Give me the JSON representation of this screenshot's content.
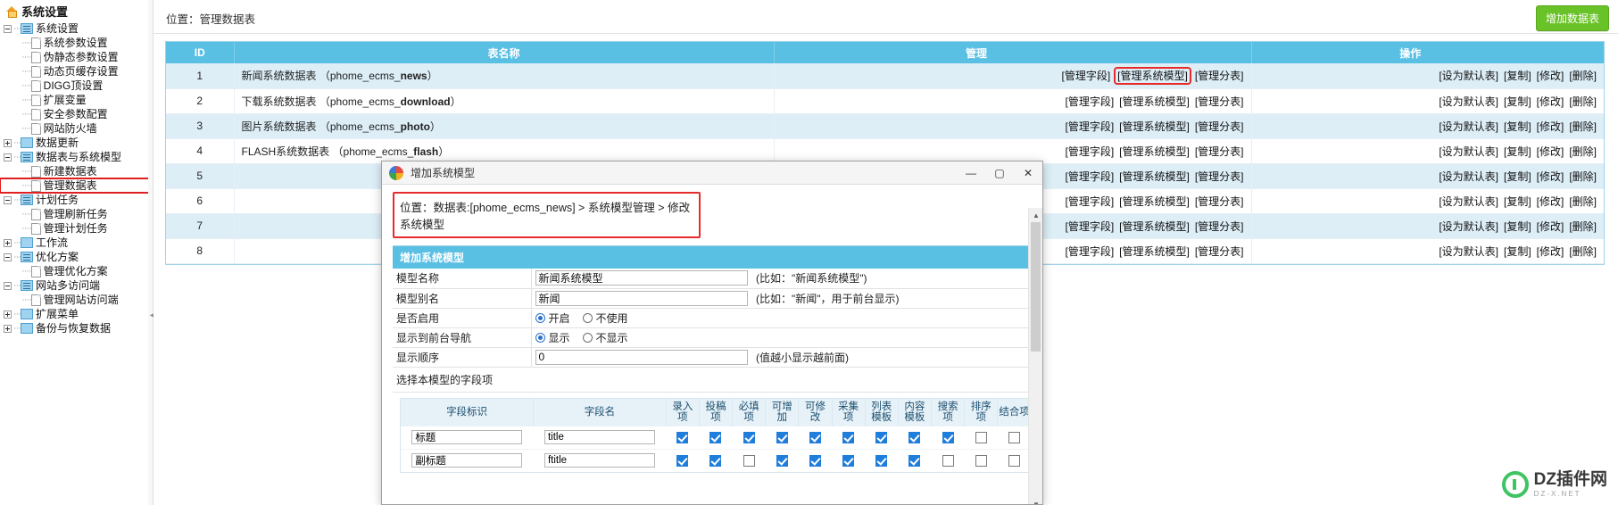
{
  "sidebar": {
    "title": "系统设置",
    "nodes": [
      {
        "level": 1,
        "toggle": "minus",
        "icon": "folder-lines-icon",
        "label": "系统设置"
      },
      {
        "level": 2,
        "icon": "page-icon",
        "label": "系统参数设置"
      },
      {
        "level": 2,
        "icon": "page-icon",
        "label": "伪静态参数设置"
      },
      {
        "level": 2,
        "icon": "page-icon",
        "label": "动态页缓存设置"
      },
      {
        "level": 2,
        "icon": "page-icon",
        "label": "DIGG顶设置"
      },
      {
        "level": 2,
        "icon": "page-icon",
        "label": "扩展变量"
      },
      {
        "level": 2,
        "icon": "page-icon",
        "label": "安全参数配置"
      },
      {
        "level": 2,
        "icon": "page-icon",
        "label": "网站防火墙"
      },
      {
        "level": 1,
        "toggle": "plus",
        "icon": "folder-icon",
        "label": "数据更新"
      },
      {
        "level": 1,
        "toggle": "minus",
        "icon": "folder-lines-icon",
        "label": "数据表与系统模型"
      },
      {
        "level": 2,
        "icon": "page-icon",
        "label": "新建数据表"
      },
      {
        "level": 2,
        "icon": "page-icon",
        "label": "管理数据表",
        "highlight": true
      },
      {
        "level": 1,
        "toggle": "minus",
        "icon": "folder-lines-icon",
        "label": "计划任务"
      },
      {
        "level": 2,
        "icon": "page-icon",
        "label": "管理刷新任务"
      },
      {
        "level": 2,
        "icon": "page-icon",
        "label": "管理计划任务"
      },
      {
        "level": 1,
        "toggle": "plus",
        "icon": "folder-icon",
        "label": "工作流"
      },
      {
        "level": 1,
        "toggle": "minus",
        "icon": "folder-lines-icon",
        "label": "优化方案"
      },
      {
        "level": 2,
        "icon": "page-icon",
        "label": "管理优化方案"
      },
      {
        "level": 1,
        "toggle": "minus",
        "icon": "folder-lines-icon",
        "label": "网站多访问端"
      },
      {
        "level": 2,
        "icon": "page-icon",
        "label": "管理网站访问端"
      },
      {
        "level": 1,
        "toggle": "plus",
        "icon": "folder-icon",
        "label": "扩展菜单"
      },
      {
        "level": 1,
        "toggle": "plus",
        "icon": "folder-icon",
        "label": "备份与恢复数据"
      }
    ]
  },
  "topbar": {
    "breadcrumb": "位置：管理数据表",
    "add_button": "增加数据表"
  },
  "table": {
    "headers": [
      "ID",
      "表名称",
      "管理",
      "操作"
    ],
    "manage_links": [
      "[管理字段]",
      "[管理系统模型]",
      "[管理分表]"
    ],
    "op_links": [
      "[设为默认表]",
      "[复制]",
      "[修改]",
      "[删除]"
    ],
    "highlighted_manage_link": "[管理系统模型]",
    "rows": [
      {
        "id": "1",
        "name_cn": "新闻系统数据表",
        "prefix": "phome_ecms_",
        "suffix": "news"
      },
      {
        "id": "2",
        "name_cn": "下载系统数据表",
        "prefix": "phome_ecms_",
        "suffix": "download"
      },
      {
        "id": "3",
        "name_cn": "图片系统数据表",
        "prefix": "phome_ecms_",
        "suffix": "photo"
      },
      {
        "id": "4",
        "name_cn": "FLASH系统数据表",
        "prefix": "phome_ecms_",
        "suffix": "flash"
      },
      {
        "id": "5",
        "name_cn": "",
        "prefix": "",
        "suffix": ""
      },
      {
        "id": "6",
        "name_cn": "",
        "prefix": "",
        "suffix": ""
      },
      {
        "id": "7",
        "name_cn": "",
        "prefix": "",
        "suffix": ""
      },
      {
        "id": "8",
        "name_cn": "",
        "prefix": "",
        "suffix": ""
      }
    ]
  },
  "dialog": {
    "title": "增加系统模型",
    "window_buttons": {
      "minimize": "—",
      "maximize": "▢",
      "close": "✕"
    },
    "breadcrumb": "位置：数据表:[phome_ecms_news] > 系统模型管理 > 修改系统模型",
    "section_header": "增加系统模型",
    "form": [
      {
        "label": "模型名称",
        "type": "text",
        "value": "新闻系统模型",
        "hint": "(比如：\"新闻系统模型\")"
      },
      {
        "label": "模型别名",
        "type": "text",
        "value": "新闻",
        "hint": "(比如：\"新闻\"，用于前台显示)"
      },
      {
        "label": "是否启用",
        "type": "radio",
        "options": [
          "开启",
          "不使用"
        ],
        "selected": 0,
        "hint": ""
      },
      {
        "label": "显示到前台导航",
        "type": "radio",
        "options": [
          "显示",
          "不显示"
        ],
        "selected": 0,
        "hint": ""
      },
      {
        "label": "显示顺序",
        "type": "text",
        "value": "0",
        "hint": "(值越小显示越前面)"
      }
    ],
    "fields_section_label": "选择本模型的字段项",
    "fields_headers": [
      "字段标识",
      "字段名",
      "录入项",
      "投稿项",
      "必填项",
      "可增加",
      "可修改",
      "采集项",
      "列表模板",
      "内容模板",
      "搜索项",
      "排序项",
      "结合项"
    ],
    "fields_rows": [
      {
        "ident": "标题",
        "name": "title",
        "checks": [
          true,
          true,
          true,
          true,
          true,
          true,
          true,
          true,
          true,
          false,
          false
        ]
      },
      {
        "ident": "副标题",
        "name": "ftitle",
        "checks": [
          true,
          true,
          false,
          true,
          true,
          true,
          true,
          true,
          false,
          false,
          false
        ]
      }
    ]
  },
  "watermark": {
    "main": "DZ插件网",
    "sub": "DZ-X.NET"
  }
}
